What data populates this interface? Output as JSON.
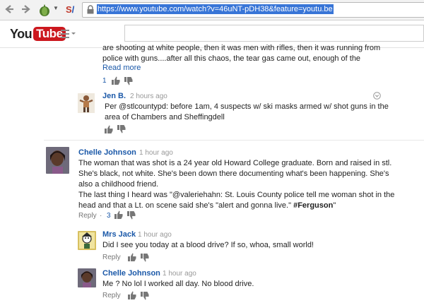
{
  "browser": {
    "url": "https://www.youtube.com/watch?v=46uNT-pDH38&feature=youtu.be",
    "icons": [
      "back-arrow",
      "forward-arrow",
      "onion-extension",
      "bookmark-extension",
      "lock"
    ]
  },
  "header": {
    "logo_you": "You",
    "logo_tube": "Tube",
    "search_placeholder": ""
  },
  "comment0": {
    "lines": [
      "are shooting at white people, then it was men with rifles, then it was running from",
      "police with guns....after all this chaos, the tear gas came out, enough of the"
    ],
    "read_more": "Read more",
    "likes": "1"
  },
  "reply_jen": {
    "author": "Jen B.",
    "time": "2 hours ago",
    "lines": [
      "Per @stlcountypd: before 1am, 4 suspects w/ ski masks armed w/ shot guns in the",
      "area of Chambers and Sheffingdell"
    ]
  },
  "comment_chelle": {
    "author": "Chelle Johnson",
    "time": "1 hour ago",
    "lines": [
      "The woman that was shot is a 24 year old Howard College graduate. Born and raised in stl.",
      "She's black, not white. She's been down there documenting what's been happening. She's",
      "also a childhood friend.",
      "The last thing I heard was \"@valeriehahn: St. Louis County police tell me woman shot in the",
      "head and that a Lt. on scene said she's \"alert and gonna live.\""
    ],
    "hashtag": "#Ferguson",
    "close_quote": "\"",
    "reply_label": "Reply",
    "separator": "·",
    "likes": "3"
  },
  "reply_jack": {
    "author": "Mrs Jack",
    "time": "1 hour ago",
    "text": "Did I see you today at a blood drive? If so, whoa, small world!",
    "reply_label": "Reply"
  },
  "reply_chelle": {
    "author": "Chelle Johnson",
    "time": "1 hour ago",
    "text": "Me ? No lol I worked all day. No blood drive.",
    "reply_label": "Reply"
  },
  "colors": {
    "link_blue": "#1a58a8",
    "url_highlight": "#3875d7",
    "youtube_red": "#cc181e"
  }
}
